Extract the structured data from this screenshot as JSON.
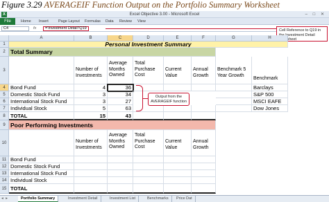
{
  "caption": {
    "figure": "Figure 3.29",
    "title": "AVERAGEIF Function Output on the Portfolio Summary Worksheet"
  },
  "window": {
    "title": "Excel Objective 3.00 - Microsoft Excel",
    "controls": "– □ ✕"
  },
  "ribbon": {
    "file": "File",
    "tabs": [
      "Home",
      "Insert",
      "Page Layout",
      "Formulas",
      "Data",
      "Review",
      "View"
    ]
  },
  "formula_bar": {
    "name_box": "C4",
    "fx": "fx",
    "formula": "='Investment Detail'!Q19"
  },
  "callouts": {
    "cell_reference": "Cell Reference to Q19 in the Investment Detail worksheet",
    "output": "Output from the AVERAGEIF function"
  },
  "columns": [
    "A",
    "B",
    "C",
    "D",
    "E",
    "F",
    "G",
    "H"
  ],
  "rows": [
    "1",
    "2",
    "3",
    "4",
    "5",
    "6",
    "7",
    "8",
    "9",
    "10",
    "11",
    "12",
    "13",
    "14",
    "15"
  ],
  "sheet": {
    "title": "Personal Investment Summary",
    "section1": "Total Summary",
    "section2": "Poor Performing Investments",
    "headers1": [
      "Number of Investments",
      "Average Months Owned",
      "Total Purchase Cost",
      "Current Value",
      "Annual Growth",
      "Benchmark 5 Year Growth",
      "Benchmark"
    ],
    "headers2": [
      "Number of Investments",
      "Average Months Owned",
      "Total Purchase Cost",
      "Current Value",
      "Annual Growth"
    ],
    "rows1": [
      {
        "label": "Bond Fund",
        "count": "4",
        "months": "36",
        "benchmark": "Barclays"
      },
      {
        "label": "Domestic Stock Fund",
        "count": "3",
        "months": "34",
        "benchmark": "S&P 500"
      },
      {
        "label": "International Stock Fund",
        "count": "3",
        "months": "27",
        "benchmark": "MSCI EAFE"
      },
      {
        "label": "Individual Stock",
        "count": "5",
        "months": "63",
        "benchmark": "Dow Jones"
      }
    ],
    "total1": {
      "label": "TOTAL",
      "count": "15",
      "months": "43"
    },
    "rows2": [
      "Bond Fund",
      "Domestic Stock Fund",
      "International Stock Fund",
      "Individual Stock"
    ],
    "total2": {
      "label": "TOTAL"
    }
  },
  "sheet_tabs": {
    "nav": "◂ ▸",
    "tabs": [
      "Portfolio Summary",
      "Investment Detail",
      "Investment List",
      "Benchmarks",
      "Price Dat"
    ],
    "active": 0
  },
  "colors": {
    "title_fill": "#fff2a8",
    "section1_fill": "#c8d6a4",
    "section2_fill": "#f3b8ac",
    "callout_border": "#c8102e",
    "excel_green": "#1f7a3a"
  }
}
